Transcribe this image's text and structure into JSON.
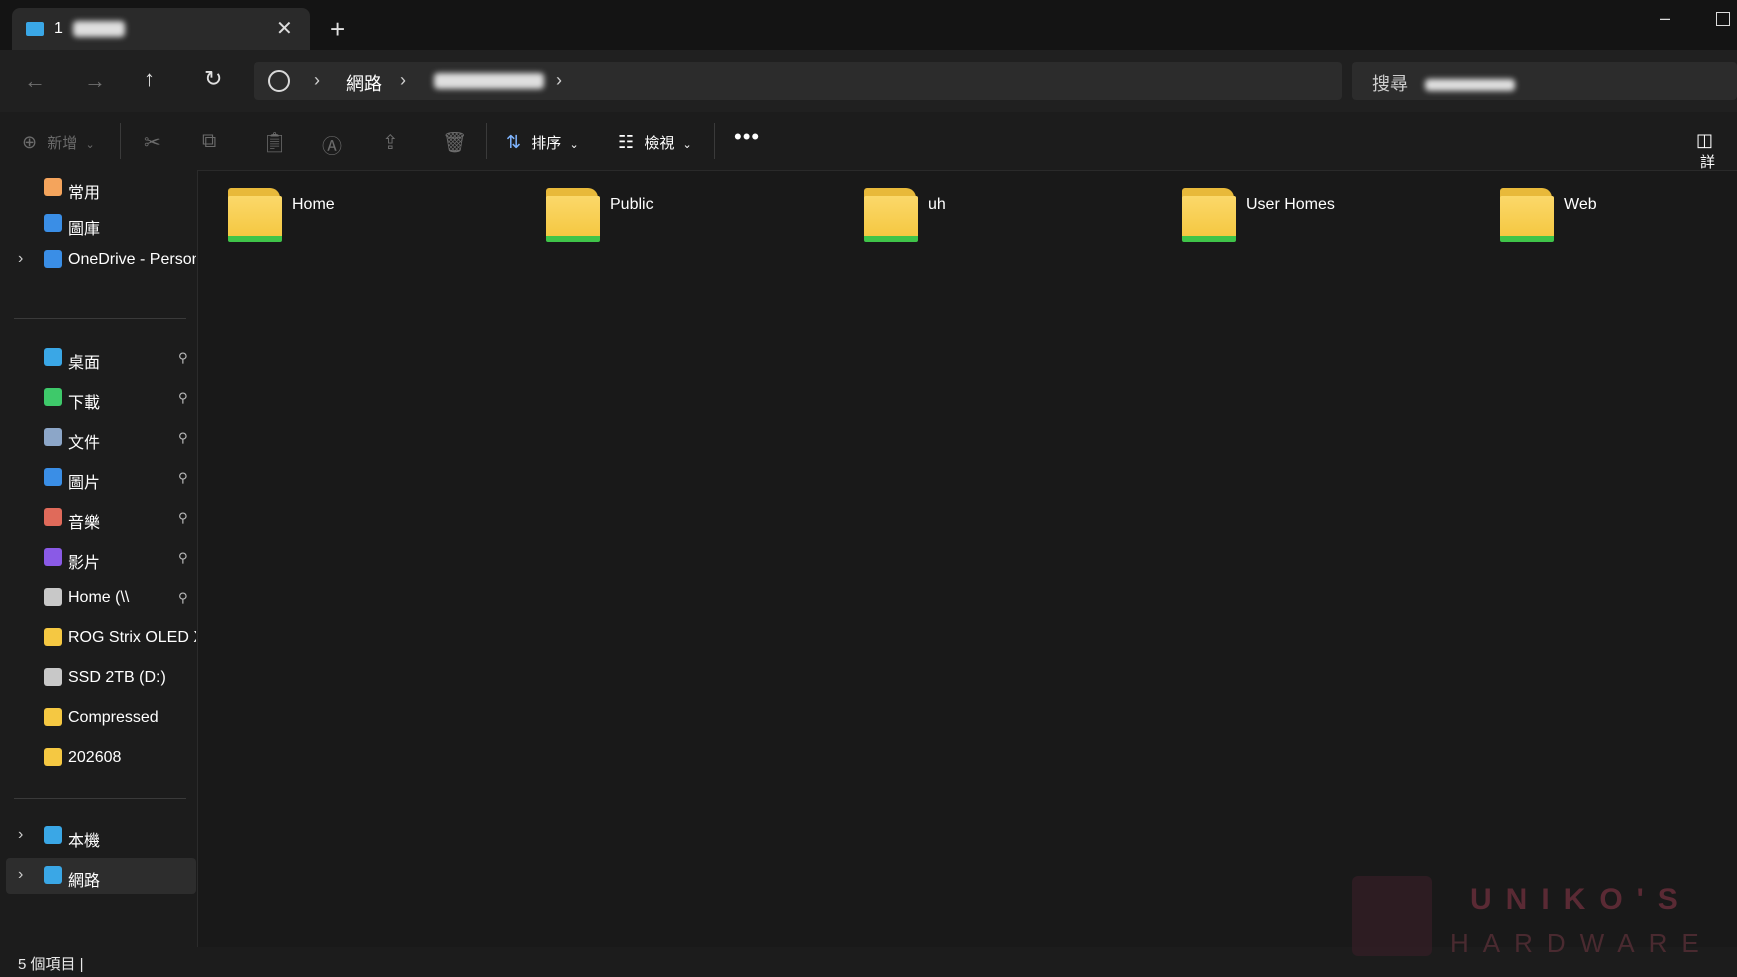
{
  "window": {
    "tab_title": "1",
    "new_tab": "+",
    "close_tab": "✕",
    "minimize": "–"
  },
  "nav": {
    "back": "←",
    "forward": "→",
    "up": "↑",
    "refresh": "↻",
    "breadcrumb_sep": "›",
    "breadcrumb": [
      "網路"
    ],
    "search_placeholder": "搜尋"
  },
  "toolbar": {
    "new_label": "新增",
    "sort_label": "排序",
    "view_label": "檢視",
    "more_label": "•••",
    "details_label": "詳"
  },
  "sidebar": {
    "top_items": [
      {
        "label": "常用",
        "icon": "home-icon",
        "color": "#f4a45c"
      },
      {
        "label": "圖庫",
        "icon": "gallery-icon",
        "color": "#3a8ee6"
      },
      {
        "label": "OneDrive - Person",
        "icon": "onedrive-icon",
        "color": "#3a8ee6"
      }
    ],
    "quick_access": [
      {
        "label": "桌面",
        "icon": "desktop-icon",
        "color": "#3aa7e6",
        "pinned": true
      },
      {
        "label": "下載",
        "icon": "download-icon",
        "color": "#3ec96a",
        "pinned": true
      },
      {
        "label": "文件",
        "icon": "document-icon",
        "color": "#8ca6c8",
        "pinned": true
      },
      {
        "label": "圖片",
        "icon": "pictures-icon",
        "color": "#3a8ee6",
        "pinned": true
      },
      {
        "label": "音樂",
        "icon": "music-icon",
        "color": "#e06a5a",
        "pinned": true
      },
      {
        "label": "影片",
        "icon": "videos-icon",
        "color": "#8a5ae6",
        "pinned": true
      },
      {
        "label": "Home (\\\\",
        "icon": "network-drive-icon",
        "color": "#c8c8c8",
        "pinned": true
      },
      {
        "label": "ROG Strix OLED X",
        "icon": "folder-icon",
        "color": "#f5c842",
        "pinned": false
      },
      {
        "label": "SSD 2TB (D:)",
        "icon": "drive-icon",
        "color": "#c8c8c8",
        "pinned": false
      },
      {
        "label": "Compressed",
        "icon": "folder-icon",
        "color": "#f5c842",
        "pinned": false
      },
      {
        "label": "202608",
        "icon": "folder-icon",
        "color": "#f5c842",
        "pinned": false
      }
    ],
    "bottom_items": [
      {
        "label": "本機",
        "icon": "this-pc-icon",
        "color": "#3aa7e6"
      },
      {
        "label": "網路",
        "icon": "network-icon",
        "color": "#3aa7e6",
        "selected": true
      }
    ],
    "pin_glyph": "📌",
    "chevron": "›"
  },
  "content": {
    "folders": [
      "Home",
      "Public",
      "uh",
      "User Homes",
      "Web"
    ]
  },
  "status": {
    "item_count": "5 個項目 |"
  },
  "watermark": {
    "line1": "UNIKO'S",
    "line2": "HARDWARE"
  }
}
